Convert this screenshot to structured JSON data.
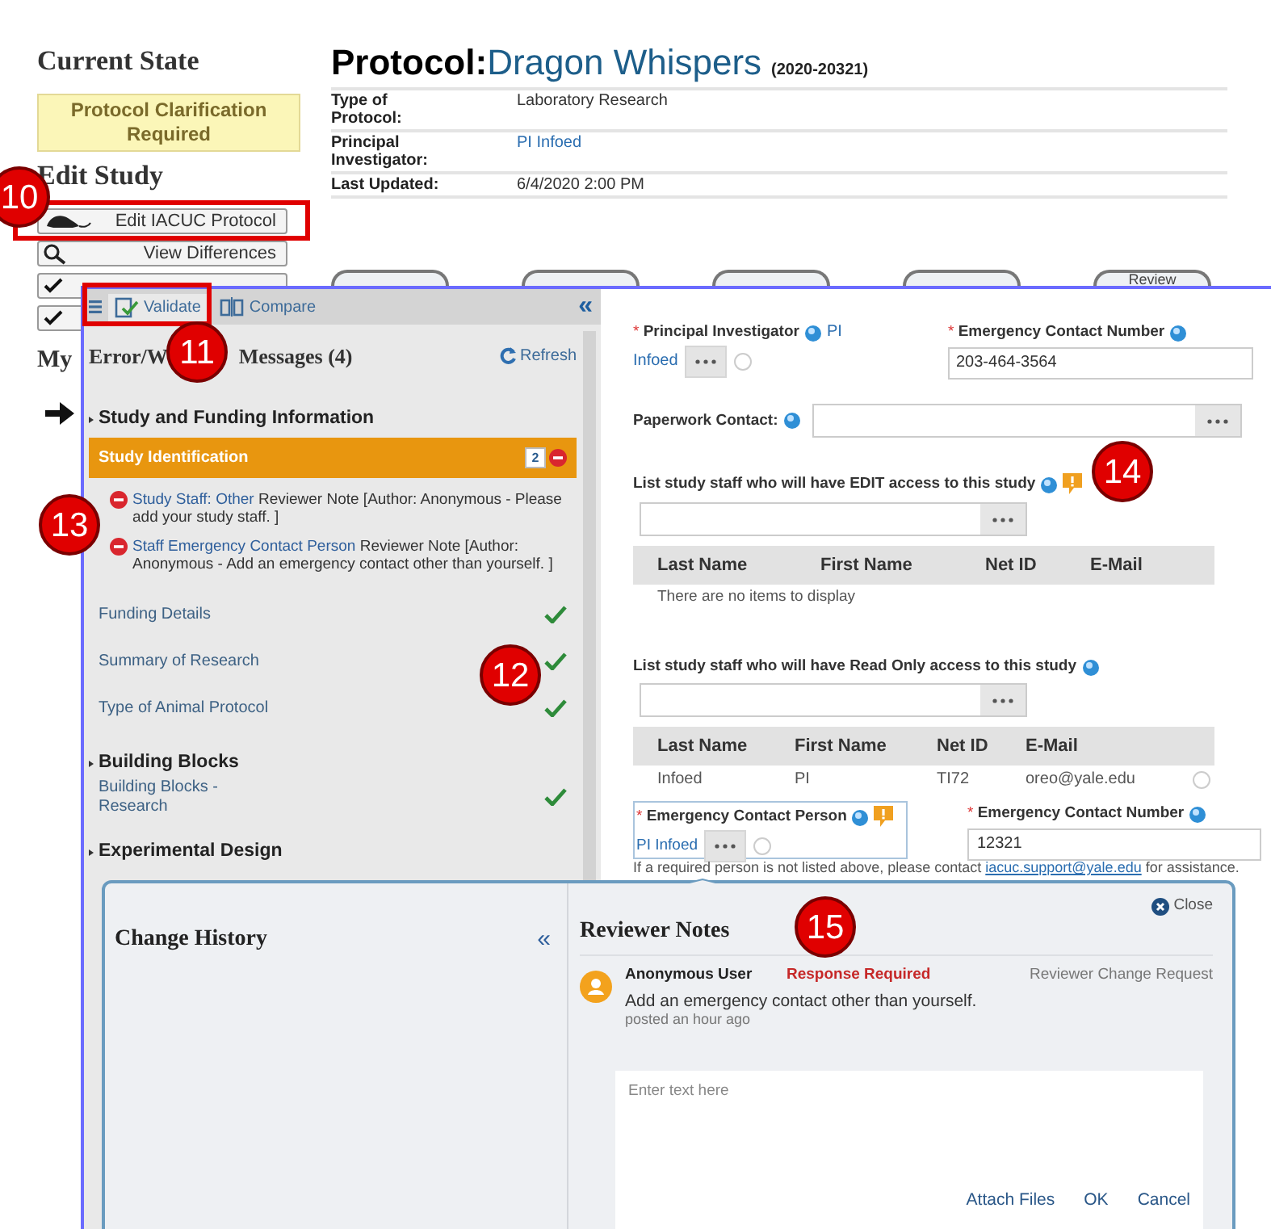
{
  "sidebar": {
    "state_heading": "Current State",
    "state": "Protocol Clarification Required",
    "edit_heading": "Edit Study",
    "actions": [
      {
        "kind": "rodent",
        "label": "Edit IACUC Protocol"
      },
      {
        "kind": "search",
        "label": "View Differences"
      },
      {
        "kind": "check"
      },
      {
        "kind": "check"
      }
    ],
    "messages_heading": "My"
  },
  "protocol": {
    "prefix": "Protocol:",
    "name": "Dragon Whispers",
    "number": "(2020-20321)",
    "fields": [
      {
        "label": "Type of Protocol:",
        "value": "Laboratory Research",
        "link": false
      },
      {
        "label": "Principal Investigator:",
        "value": "PI Infoed",
        "link": true
      },
      {
        "label": "Last Updated:",
        "value": "6/4/2020 2:00 PM",
        "link": false
      }
    ]
  },
  "workflow_steps": [
    {
      "kind": "covered"
    },
    {
      "kind": "covered"
    },
    {
      "kind": "covered"
    },
    {
      "kind": "covered"
    },
    {
      "kind": "labeled",
      "label": "Review"
    }
  ],
  "validation_panel": {
    "tabs": [
      {
        "label": "Validate",
        "selected": true
      },
      {
        "label": "Compare",
        "selected": false
      }
    ],
    "collapse": "«",
    "heading_start": "Error/W",
    "heading_end": "Messages (4)",
    "refresh": "Refresh",
    "sections": [
      {
        "title": "Study and Funding Information",
        "items": [
          {
            "label": "Study Identification",
            "selected": true,
            "valid": false,
            "comments": "2",
            "messages": [
              {
                "link": "Study Staff: Other",
                "text": "Reviewer Note [Author: Anonymous - Please add your study staff. ]"
              },
              {
                "link": "Staff Emergency Contact Person",
                "text": "Reviewer Note [Author: Anonymous - Add an emergency contact other than yourself. ]"
              }
            ]
          },
          {
            "label": "Funding Details",
            "selected": false,
            "valid": true
          },
          {
            "label": "Summary of Research",
            "selected": false,
            "valid": true
          },
          {
            "label": "Type of Animal Protocol",
            "selected": false,
            "valid": true
          }
        ]
      },
      {
        "title": "Building Blocks",
        "items": [
          {
            "label": "Building Blocks - Research",
            "selected": false,
            "valid": true
          }
        ]
      },
      {
        "title": "Experimental Design"
      }
    ]
  },
  "form": {
    "pi": {
      "mark": "*",
      "label": "Principal Investigator",
      "value_parts": [
        "PI",
        "Infoed"
      ]
    },
    "pi_contact_number": {
      "mark": "*",
      "label": "Emergency Contact Number",
      "value": "203-464-3564"
    },
    "paperwork": {
      "label": "Paperwork Contact:"
    },
    "edit_staff": {
      "label": "List study staff who will have EDIT access to this study",
      "flagged": true,
      "columns": [
        "Last Name",
        "First Name",
        "Net ID",
        "E-Mail"
      ],
      "empty": "There are no items to display"
    },
    "readonly_staff": {
      "label": "List study staff who will have Read Only access to this study",
      "flagged": false,
      "columns": [
        "Last Name",
        "First Name",
        "Net ID",
        "E-Mail"
      ],
      "rows": [
        [
          "Infoed",
          "PI",
          "TI72",
          "oreo@yale.edu"
        ]
      ]
    },
    "emergency_person": {
      "mark": "*",
      "label": "Emergency Contact Person",
      "flagged": true,
      "value": "PI Infoed"
    },
    "emergency_number": {
      "mark": "*",
      "label": "Emergency Contact Number",
      "value": "12321"
    },
    "help": {
      "before": "If a required person is not listed above, please contact",
      "link": "iacuc.support@yale.edu",
      "after": "for assistance."
    }
  },
  "popup": {
    "change_history": {
      "title": "Change History",
      "collapse": "«"
    },
    "reviewer_notes": {
      "title": "Reviewer Notes",
      "close": "Close",
      "notes": [
        {
          "author": "Anonymous User",
          "status": "Response Required",
          "type": "Reviewer Change Request",
          "text": "Add an emergency contact other than yourself.",
          "time": "posted an hour ago"
        }
      ],
      "reply": {
        "placeholder": "Enter text here",
        "actions": [
          "Attach Files",
          "OK",
          "Cancel"
        ]
      }
    }
  },
  "annotations": [
    {
      "number": "10",
      "box": true
    },
    {
      "number": "11",
      "box": true
    },
    {
      "number": "12",
      "box": false
    },
    {
      "number": "13",
      "box": false
    },
    {
      "number": "14",
      "box": false
    },
    {
      "number": "15",
      "box": false
    }
  ]
}
